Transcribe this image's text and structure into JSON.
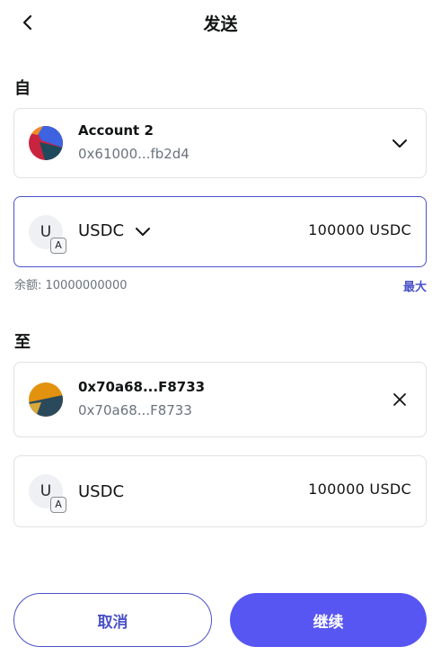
{
  "header": {
    "title": "发送",
    "back_icon": "chevron-left-icon"
  },
  "from": {
    "label": "自",
    "account_name": "Account 2",
    "account_address": "0x61000...fb2d4",
    "expand_icon": "chevron-down-icon"
  },
  "asset": {
    "token_letter": "U",
    "token_badge": "A",
    "token_symbol": "USDC",
    "amount": "100000  USDC",
    "balance": "余额: 10000000000",
    "max_label": "最大"
  },
  "to": {
    "label": "至",
    "recipient_name": "0x70a68...F8733",
    "recipient_address": "0x70a68...F8733",
    "clear_icon": "close-icon"
  },
  "receive": {
    "token_letter": "U",
    "token_badge": "A",
    "token_symbol": "USDC",
    "amount": "100000  USDC"
  },
  "footer": {
    "cancel_label": "取消",
    "continue_label": "继续"
  },
  "colors": {
    "accent": "#4a52c8",
    "primary_button": "#5856f2",
    "border": "#dfe1e4",
    "muted_text": "#6a737d"
  }
}
